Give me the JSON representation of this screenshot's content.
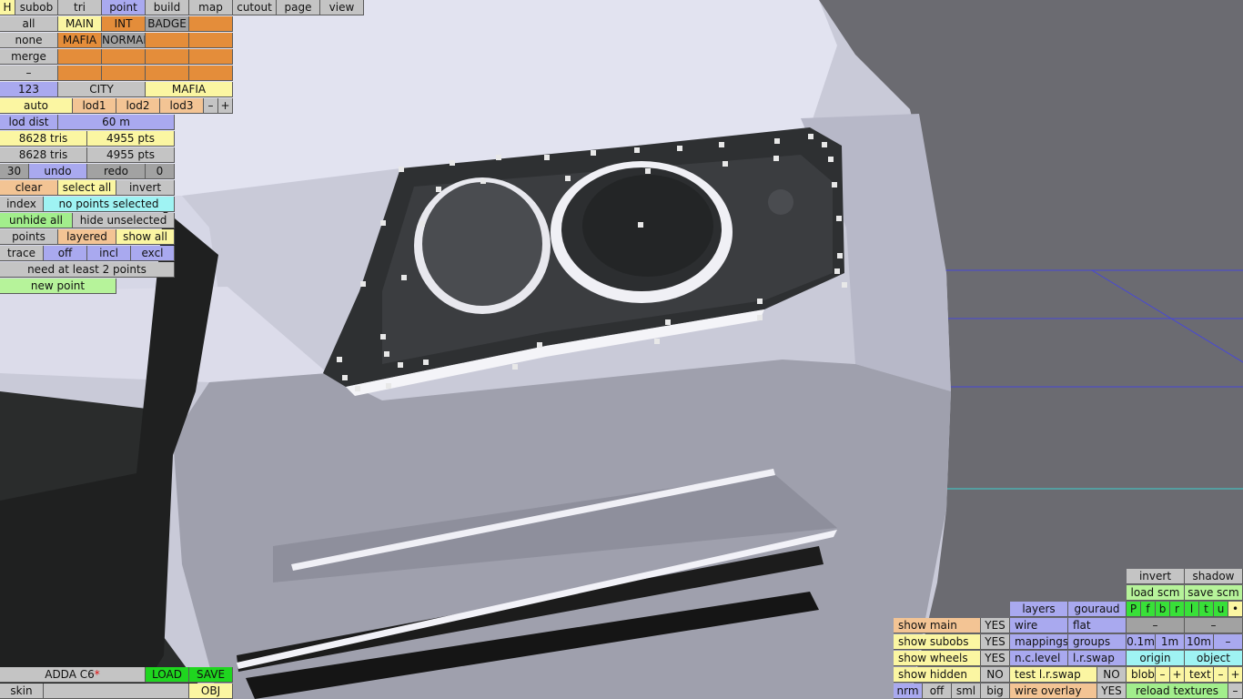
{
  "toolbar": {
    "h": "H",
    "subob": "subob",
    "tri": "tri",
    "point": "point",
    "build": "build",
    "map": "map",
    "cutout": "cutout",
    "page": "page",
    "view": "view"
  },
  "left_panel": {
    "all": "all",
    "main": "MAIN",
    "int": "INT",
    "badge": "BADGE",
    "none": "none",
    "mafia": "MAFIA",
    "normal": "NORMAL",
    "merge": "merge",
    "dash": "–",
    "n123": "123",
    "city": "CITY",
    "mafia2": "MAFIA",
    "auto": "auto",
    "lod1": "lod1",
    "lod2": "lod2",
    "lod3": "lod3",
    "minus": "–",
    "plus": "+",
    "lod_dist": "lod dist",
    "lod_dist_val": "60 m",
    "tris1": "8628 tris",
    "pts1": "4955 pts",
    "tris2": "8628 tris",
    "pts2": "4955 pts",
    "undo_count": "30",
    "undo": "undo",
    "redo": "redo",
    "redo_count": "0",
    "clear": "clear",
    "select_all": "select all",
    "invert": "invert",
    "index": "index",
    "no_points_selected": "no points selected",
    "unhide_all": "unhide all",
    "hide_unselected": "hide unselected",
    "points": "points",
    "layered": "layered",
    "show_all": "show all",
    "trace": "trace",
    "off": "off",
    "incl": "incl",
    "excl": "excl",
    "need_points": "need at least 2 points",
    "new_point": "new point"
  },
  "bottom_left": {
    "filename": "ADDA C6",
    "modified_mark": "*",
    "load": "LOAD",
    "save": "SAVE",
    "skin": "skin",
    "obj": "OBJ"
  },
  "bottom_right": {
    "invert": "invert",
    "shadow": "shadow",
    "load_scm": "load scm",
    "save_scm": "save scm",
    "flags": [
      "P",
      "f",
      "b",
      "r",
      "l",
      "t",
      "u",
      "•"
    ],
    "layers": "layers",
    "gouraud": "gouraud",
    "wire": "wire",
    "flat": "flat",
    "dash": "–",
    "show_main": "show main",
    "show_main_val": "YES",
    "show_subobs": "show subobs",
    "show_subobs_val": "YES",
    "show_wheels": "show wheels",
    "show_wheels_val": "YES",
    "show_hidden": "show hidden",
    "show_hidden_val": "NO",
    "mappings": "mappings",
    "groups": "groups",
    "d01": "0.1m",
    "d1": "1m",
    "d10": "10m",
    "minus": "–",
    "nclevel": "n.c.level",
    "lrswap": "l.r.swap",
    "origin": "origin",
    "object": "object",
    "test_lrswap": "test l.r.swap",
    "test_lrswap_val": "NO",
    "blob": "blob",
    "text": "text",
    "plus": "+",
    "nrm": "nrm",
    "off": "off",
    "sml": "sml",
    "big": "big",
    "wire_overlay": "wire overlay",
    "wire_overlay_val": "YES",
    "reload_textures": "reload textures"
  }
}
